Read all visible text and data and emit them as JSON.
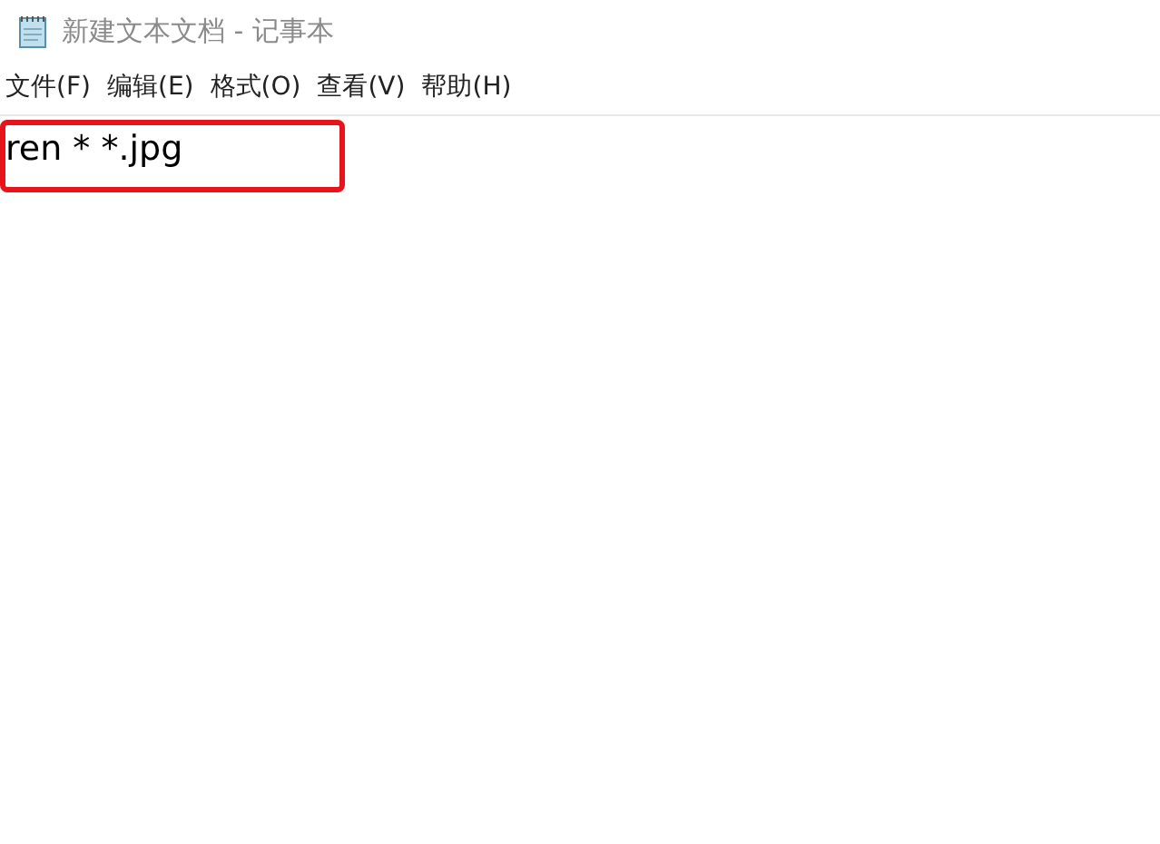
{
  "window": {
    "title": "新建文本文档 - 记事本"
  },
  "menu": [
    "文件(F)",
    "编辑(E)",
    "格式(O)",
    "查看(V)",
    "帮助(H)"
  ],
  "editor": {
    "lines": [
      "ren * *.jpg"
    ],
    "highlighted": true
  }
}
